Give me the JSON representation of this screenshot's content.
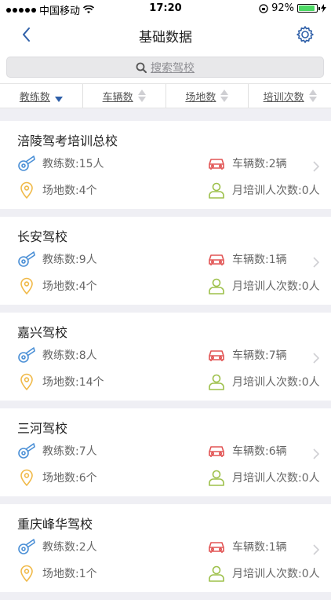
{
  "status_bar": {
    "carrier": "中国移动",
    "time": "17:20",
    "battery": "92%",
    "battery_level": 0.92
  },
  "nav": {
    "title": "基础数据"
  },
  "search": {
    "placeholder": "搜索驾校"
  },
  "sort_tabs": [
    {
      "label": "教练数",
      "state": "desc"
    },
    {
      "label": "车辆数",
      "state": "none"
    },
    {
      "label": "场地数",
      "state": "none"
    },
    {
      "label": "培训次数",
      "state": "none"
    }
  ],
  "schools": [
    {
      "name": "涪陵驾考培训总校",
      "coaches": "教练数:15人",
      "vehicles": "车辆数:2辆",
      "sites": "场地数:4个",
      "monthly": "月培训人次数:0人"
    },
    {
      "name": "长安驾校",
      "coaches": "教练数:9人",
      "vehicles": "车辆数:1辆",
      "sites": "场地数:4个",
      "monthly": "月培训人次数:0人"
    },
    {
      "name": "嘉兴驾校",
      "coaches": "教练数:8人",
      "vehicles": "车辆数:7辆",
      "sites": "场地数:14个",
      "monthly": "月培训人次数:0人"
    },
    {
      "name": "三河驾校",
      "coaches": "教练数:7人",
      "vehicles": "车辆数:6辆",
      "sites": "场地数:6个",
      "monthly": "月培训人次数:0人"
    },
    {
      "name": "重庆峰华驾校",
      "coaches": "教练数:2人",
      "vehicles": "车辆数:1辆",
      "sites": "场地数:1个",
      "monthly": "月培训人次数:0人"
    }
  ],
  "colors": {
    "nav_blue": "#2e5fa8",
    "whistle": "#4a8fd6",
    "car": "#e25555",
    "pin": "#f0b948",
    "person": "#9dc04a"
  }
}
